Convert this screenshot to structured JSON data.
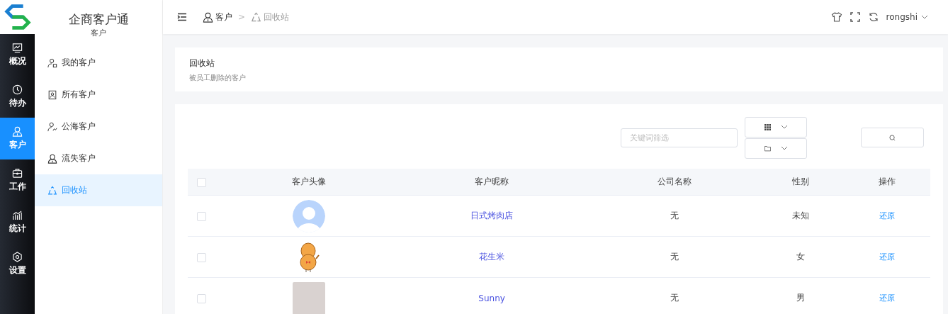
{
  "app": {
    "title": "企商客户通",
    "section": "客户"
  },
  "rail": [
    {
      "label": "概况",
      "kind": "chart",
      "selected": false
    },
    {
      "label": "待办",
      "kind": "clock",
      "selected": false
    },
    {
      "label": "客户",
      "kind": "user",
      "selected": true
    },
    {
      "label": "工作",
      "kind": "briefcase",
      "selected": false
    },
    {
      "label": "统计",
      "kind": "bars",
      "selected": false
    },
    {
      "label": "设置",
      "kind": "gear",
      "selected": false
    }
  ],
  "submenu": [
    {
      "label": "我的客户",
      "kind": "user-badge",
      "selected": false
    },
    {
      "label": "所有客户",
      "kind": "contact-card",
      "selected": false
    },
    {
      "label": "公海客户",
      "kind": "user-share",
      "selected": false
    },
    {
      "label": "流失客户",
      "kind": "user",
      "selected": false
    },
    {
      "label": "回收站",
      "kind": "recycle",
      "selected": true
    }
  ],
  "breadcrumb": [
    {
      "label": "客户",
      "kind": "user"
    },
    {
      "label": "回收站",
      "kind": "recycle"
    }
  ],
  "breadcrumb_separator": ">",
  "user": {
    "name": "rongshi"
  },
  "page_header": {
    "title": "回收站",
    "subtitle": "被员工删除的客户"
  },
  "filter": {
    "placeholder": "关键词筛选"
  },
  "table": {
    "select_all_checked": false,
    "columns": [
      "客户头像",
      "客户昵称",
      "公司名称",
      "性别",
      "操作"
    ],
    "rows": [
      {
        "checked": false,
        "kind": "default",
        "nickname": "日式烤肉店",
        "company": "无",
        "gender": "未知",
        "action": "还原"
      },
      {
        "checked": false,
        "kind": "cartoon",
        "nickname": "花生米",
        "company": "无",
        "gender": "女",
        "action": "还原"
      },
      {
        "checked": false,
        "kind": "photo",
        "nickname": "Sunny",
        "company": "无",
        "gender": "男",
        "action": "还原"
      }
    ]
  }
}
